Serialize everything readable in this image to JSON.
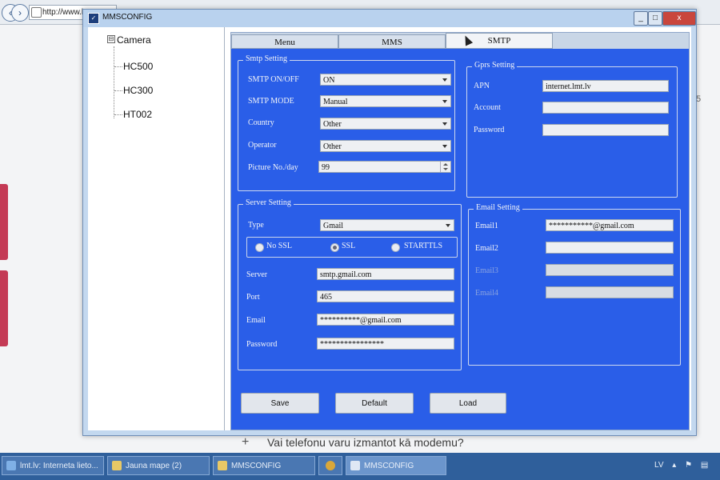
{
  "browser": {
    "url": "http://www.lmt.",
    "caption_plus": "+",
    "caption": "Vai telefonu varu izmantot kā modemu?",
    "right_edge_text": "5"
  },
  "taskbar": {
    "items": [
      {
        "label": "lmt.lv: Interneta lieto..."
      },
      {
        "label": "Jauna mape (2)"
      },
      {
        "label": "MMSCONFIG"
      },
      {
        "label": ""
      },
      {
        "label": "MMSCONFIG"
      }
    ],
    "tray": {
      "lang": "LV"
    }
  },
  "window": {
    "title": "MMSCONFIG",
    "buttons": {
      "minimize": "_",
      "maximize": "□",
      "close": "x"
    }
  },
  "tree": {
    "root": "Camera",
    "expander": "⊟",
    "children": [
      "HC500",
      "HC300",
      "HT002"
    ]
  },
  "tabs": [
    "Menu",
    "MMS",
    "SMTP"
  ],
  "active_tab": "SMTP",
  "smtp_setting": {
    "title": "Smtp Setting",
    "on_off_label": "SMTP ON/OFF",
    "on_off_value": "ON",
    "mode_label": "SMTP MODE",
    "mode_value": "Manual",
    "country_label": "Country",
    "country_value": "Other",
    "operator_label": "Operator",
    "operator_value": "Other",
    "picture_label": "Picture No./day",
    "picture_value": "99"
  },
  "gprs_setting": {
    "title": "Gprs Setting",
    "apn_label": "APN",
    "apn_value": "internet.lmt.lv",
    "account_label": "Account",
    "account_value": "",
    "password_label": "Password",
    "password_value": ""
  },
  "server_setting": {
    "title": "Server Setting",
    "type_label": "Type",
    "type_value": "Gmail",
    "ssl_options": [
      "No SSL",
      "SSL",
      "STARTTLS"
    ],
    "ssl_selected": "SSL",
    "server_label": "Server",
    "server_value": "smtp.gmail.com",
    "port_label": "Port",
    "port_value": "465",
    "email_label": "Email",
    "email_value": "**********@gmail.com",
    "password_label": "Password",
    "password_value": "****************"
  },
  "email_setting": {
    "title": "Email Setting",
    "email1_label": "Email1",
    "email1_value": "***********@gmail.com",
    "email2_label": "Email2",
    "email2_value": "",
    "email3_label": "Email3",
    "email3_value": "",
    "email4_label": "Email4",
    "email4_value": ""
  },
  "buttons": {
    "save": "Save",
    "default": "Default",
    "load": "Load"
  },
  "colors": {
    "panel_blue": "#2a5ee8",
    "label_text": "#f2f4f7",
    "taskbar": "#2f5f9b"
  }
}
